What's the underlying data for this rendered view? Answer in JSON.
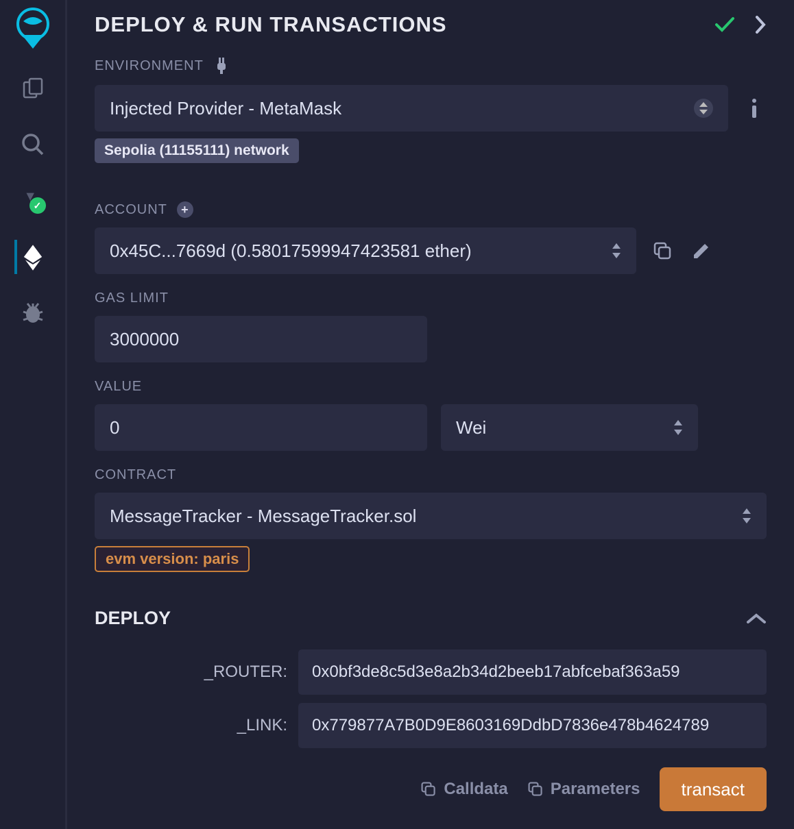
{
  "header": {
    "title": "DEPLOY & RUN TRANSACTIONS"
  },
  "environment": {
    "label": "ENVIRONMENT",
    "selected": "Injected Provider - MetaMask",
    "network_chip": "Sepolia (11155111) network"
  },
  "account": {
    "label": "ACCOUNT",
    "selected": "0x45C...7669d (0.58017599947423581 ether)"
  },
  "gas_limit": {
    "label": "GAS LIMIT",
    "value": "3000000"
  },
  "value": {
    "label": "VALUE",
    "amount": "0",
    "unit": "Wei"
  },
  "contract": {
    "label": "CONTRACT",
    "selected": "MessageTracker - MessageTracker.sol",
    "evm_chip": "evm version: paris"
  },
  "deploy": {
    "title": "DEPLOY",
    "params": [
      {
        "label": "_ROUTER:",
        "value": "0x0bf3de8c5d3e8a2b34d2beeb17abfcebaf363a59"
      },
      {
        "label": "_LINK:",
        "value": "0x779877A7B0D9E8603169DdbD7836e478b4624789"
      }
    ],
    "actions": {
      "calldata": "Calldata",
      "parameters": "Parameters",
      "transact": "transact"
    }
  }
}
